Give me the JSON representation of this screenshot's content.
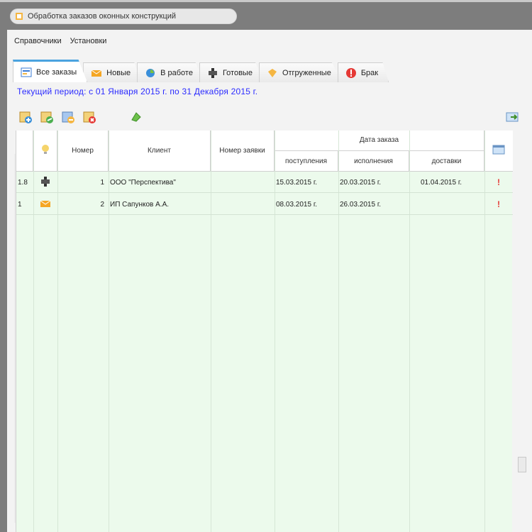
{
  "window": {
    "title": "Обработка заказов оконных конструкций",
    "app_icon": "app-icon"
  },
  "menu": [
    "Справочники",
    "Установки"
  ],
  "tabs": [
    {
      "label": "Все заказы",
      "icon": "all-orders-icon",
      "active": true
    },
    {
      "label": "Новые",
      "icon": "new-orders-icon",
      "active": false
    },
    {
      "label": "В работе",
      "icon": "in-progress-icon",
      "active": false
    },
    {
      "label": "Готовые",
      "icon": "ready-icon",
      "active": false
    },
    {
      "label": "Отгруженные",
      "icon": "shipped-icon",
      "active": false
    },
    {
      "label": "Брак",
      "icon": "defect-icon",
      "active": false
    }
  ],
  "period_text": "Текущий период: с 01 Января 2015 г. по 31 Декабря 2015 г.",
  "toolbar": {
    "buttons": [
      "add-order-icon",
      "edit-order-icon",
      "copy-order-icon",
      "delete-order-icon"
    ],
    "refresh": "refresh-icon",
    "export": "export-icon"
  },
  "columns": {
    "number": "Номер",
    "client": "Клиент",
    "contract": "Номер заявки",
    "dates_group": "Дата заказа",
    "date_received": "поступления",
    "date_done": "исполнения",
    "date_delivery": "доставки"
  },
  "rows": [
    {
      "marker": "1.8",
      "status_icon": "ready-icon",
      "number": "1",
      "client": "ООО \"Перспектива\"",
      "contract": "",
      "date_received": "15.03.2015 г.",
      "date_done": "20.03.2015 г.",
      "date_delivery": "01.04.2015 г.",
      "warn": "!"
    },
    {
      "marker": "1",
      "status_icon": "new-orders-icon",
      "number": "2",
      "client": "ИП Сапунков А.А.",
      "contract": "",
      "date_received": "08.03.2015 г.",
      "date_done": "26.03.2015 г.",
      "date_delivery": "",
      "warn": "!"
    }
  ],
  "colors": {
    "grid_bg": "#ecfaec",
    "period_text": "#2b2bff",
    "tab_active_accent": "#4aa3df",
    "warn": "#e53935"
  }
}
